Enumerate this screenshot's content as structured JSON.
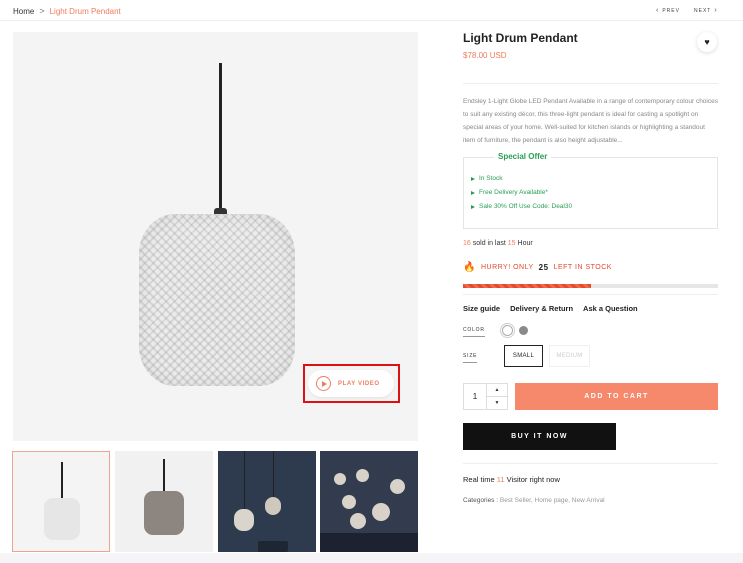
{
  "breadcrumb": {
    "home": "Home",
    "separator": ">",
    "current": "Light Drum Pendant"
  },
  "pager": {
    "prev": "PREV",
    "next": "NEXT",
    "prev_icon": "chevron-left-icon",
    "next_icon": "chevron-right-icon"
  },
  "media": {
    "play_video_label": "PLAY VIDEO",
    "play_icon": "play-icon"
  },
  "product": {
    "title": "Light Drum Pendant",
    "price": "$78.00 USD",
    "wishlist_icon": "heart-icon",
    "description": "Endsley 1-Light Globe LED Pendant Available in a range of contemporary colour choices to suit any existing décor, this three-light pendant is ideal for casting a spotlight on special areas of your home. Well-suited for kitchen islands or highlighting a standout item of furniture, the pendant is also height adjustable..."
  },
  "offer": {
    "title": "Special Offer",
    "items": [
      "In Stock",
      "Free Delivery Available*",
      "Sale 30% Off Use Code: Deal30"
    ]
  },
  "sold": {
    "count": "16",
    "mid": "sold in last",
    "hours": "15",
    "unit": "Hour"
  },
  "stock": {
    "prefix": "HURRY! ONLY",
    "count": "25",
    "suffix": "LEFT IN STOCK",
    "level": 0.5,
    "fire_icon": "fire-icon"
  },
  "tabs": [
    "Size guide",
    "Delivery & Return",
    "Ask a Question"
  ],
  "color": {
    "label": "COLOR",
    "options": [
      "white",
      "grey"
    ],
    "selected": "white"
  },
  "size": {
    "label": "SIZE",
    "options": [
      "SMALL",
      "MEDIUM"
    ],
    "selected": "SMALL"
  },
  "quantity": {
    "value": "1",
    "up": "▲",
    "down": "▼"
  },
  "actions": {
    "add_to_cart": "ADD TO CART",
    "buy_now": "BUY IT NOW"
  },
  "visitors": {
    "prefix": "Real time",
    "count": "11",
    "suffix": "Visitor right now"
  },
  "categories": {
    "label": "Categories :",
    "links": "Best Seller, Home page, New Arrival"
  },
  "colors": {
    "accent": "#f07c5e",
    "offer_green": "#2a9d55",
    "dark": "#111111"
  }
}
